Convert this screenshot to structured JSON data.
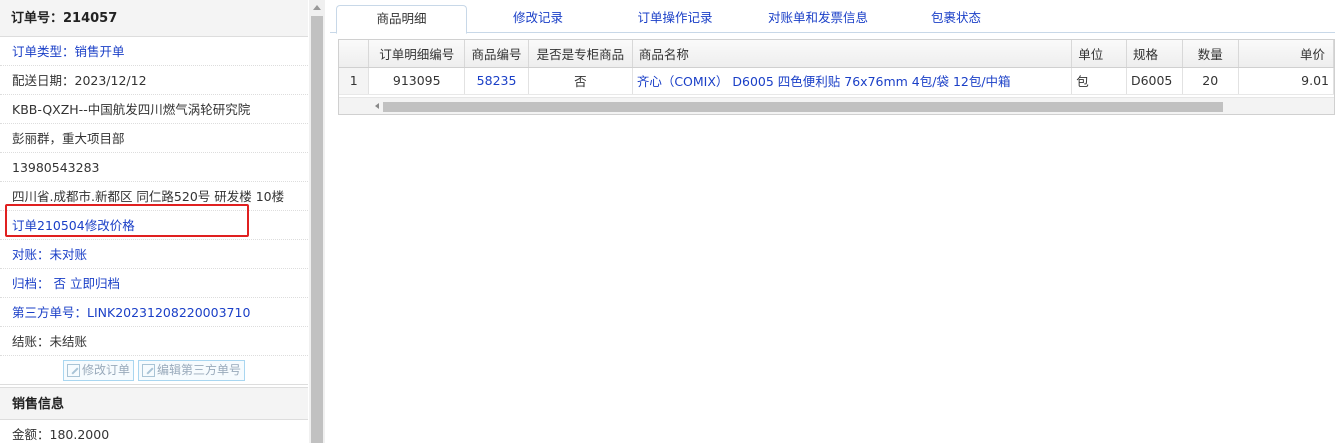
{
  "order": {
    "header": "订单号：214057",
    "rows": [
      {
        "text": "订单类型：销售开单",
        "style": "link"
      },
      {
        "text": "配送日期：2023/12/12",
        "style": "plain"
      },
      {
        "text": "KBB-QXZH--中国航发四川燃气涡轮研究院",
        "style": "plain"
      },
      {
        "text": "彭丽群，重大项目部",
        "style": "plain"
      },
      {
        "text": "13980543283",
        "style": "plain"
      },
      {
        "text": "四川省.成都市.新都区 同仁路520号 研发楼 10楼",
        "style": "plain"
      },
      {
        "text": "订单210504修改价格",
        "style": "link"
      },
      {
        "text": "对账：未对账",
        "style": "link"
      },
      {
        "text": "归档：  否 立即归档",
        "style": "link"
      },
      {
        "text": "第三方单号：LINK20231208220003710",
        "style": "link"
      },
      {
        "text": "结账：未结账",
        "style": "plain"
      }
    ],
    "buttons": {
      "edit_order": "修改订单",
      "edit_third_party": "编辑第三方单号"
    }
  },
  "sales": {
    "header": "销售信息",
    "amount": "金额：180.2000"
  },
  "tabs": [
    "商品明细",
    "修改记录",
    "订单操作记录",
    "对账单和发票信息",
    "包裹状态"
  ],
  "grid": {
    "columns": [
      "",
      "订单明细编号",
      "商品编号",
      "是否是专柜商品",
      "商品名称",
      "单位",
      "规格",
      "数量",
      "单价"
    ],
    "rows": [
      [
        "1",
        "913095",
        "58235",
        "否",
        "齐心（COMIX） D6005 四色便利贴 76x76mm 4包/袋 12包/中箱",
        "包",
        "D6005",
        "20",
        "9.01"
      ]
    ]
  },
  "colors": {
    "link": "#1a3fc7",
    "highlight": "#e02020"
  }
}
